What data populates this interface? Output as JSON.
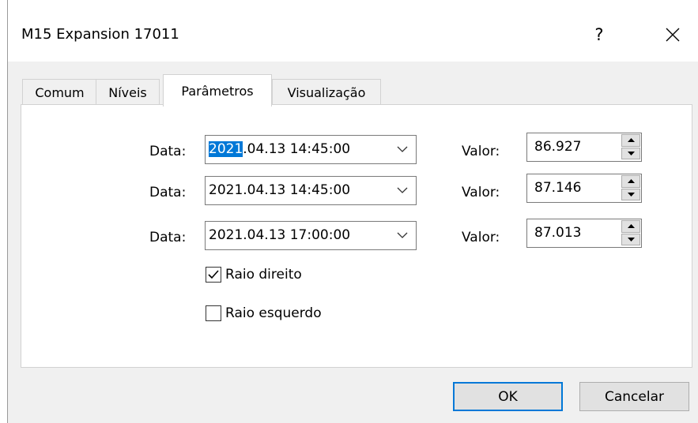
{
  "window": {
    "title": "M15 Expansion 17011",
    "help_label": "?"
  },
  "tabs": [
    {
      "label": "Comum"
    },
    {
      "label": "Níveis"
    },
    {
      "label": "Parâmetros"
    },
    {
      "label": "Visualização"
    }
  ],
  "active_tab": "Parâmetros",
  "points": [
    {
      "date_label": "Data:",
      "date_selected": "2021",
      "date_rest": ".04.13 14:45:00",
      "value_label": "Valor:",
      "value": "86.927"
    },
    {
      "date_label": "Data:",
      "date": "2021.04.13 14:45:00",
      "value_label": "Valor:",
      "value": "87.146"
    },
    {
      "date_label": "Data:",
      "date": "2021.04.13 17:00:00",
      "value_label": "Valor:",
      "value": "87.013"
    }
  ],
  "options": {
    "ray_right": {
      "label": "Raio direito",
      "checked": true
    },
    "ray_left": {
      "label": "Raio esquerdo",
      "checked": false
    }
  },
  "buttons": {
    "ok": "OK",
    "cancel": "Cancelar"
  },
  "colors": {
    "selection": "#0078d7",
    "focus_border": "#0078d7"
  }
}
